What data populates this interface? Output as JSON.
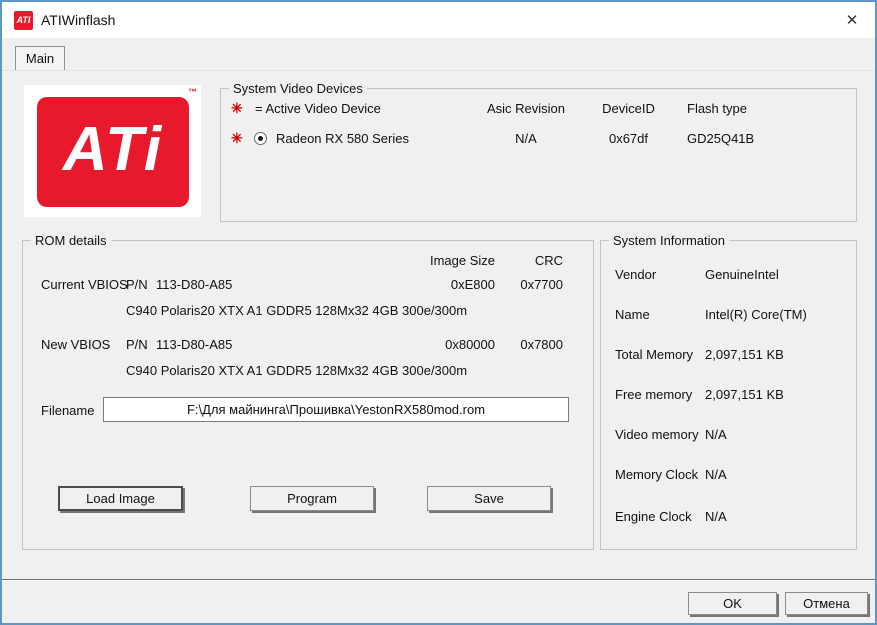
{
  "window": {
    "title": "ATIWinflash",
    "close_glyph": "✕"
  },
  "app_icon_text": "ATI",
  "tabs": {
    "main": "Main"
  },
  "logo": {
    "text": "ATi",
    "tm": "™"
  },
  "devices": {
    "legend": "System Video Devices",
    "marker_glyph": "✳",
    "active_label": "= Active Video Device",
    "col_asic": "Asic Revision",
    "col_deviceid": "DeviceID",
    "col_flashtype": "Flash type",
    "device": {
      "name": "Radeon RX 580 Series",
      "asic": "N/A",
      "deviceid": "0x67df",
      "flashtype": "GD25Q41B"
    }
  },
  "rom": {
    "legend": "ROM details",
    "col_image_size": "Image Size",
    "col_crc": "CRC",
    "current": {
      "label": "Current VBIOS",
      "pn_label": "P/N",
      "pn": "113-D80-A85",
      "size": "0xE800",
      "crc": "0x7700",
      "desc": "C940 Polaris20 XTX A1 GDDR5 128Mx32 4GB 300e/300m"
    },
    "new": {
      "label": "New VBIOS",
      "pn_label": "P/N",
      "pn": "113-D80-A85",
      "size": "0x80000",
      "crc": "0x7800",
      "desc": "C940 Polaris20 XTX A1 GDDR5 128Mx32 4GB 300e/300m"
    },
    "filename_label": "Filename",
    "filename_value": "F:\\Для майнинга\\Прошивка\\YestonRX580mod.rom",
    "buttons": {
      "load": "Load Image",
      "program": "Program",
      "save": "Save"
    }
  },
  "sysinfo": {
    "legend": "System Information",
    "rows": [
      {
        "label": "Vendor",
        "value": "GenuineIntel"
      },
      {
        "label": "Name",
        "value": "Intel(R) Core(TM)"
      },
      {
        "label": "Total Memory",
        "value": "2,097,151 KB"
      },
      {
        "label": "Free memory",
        "value": "2,097,151 KB"
      },
      {
        "label": "Video memory",
        "value": "N/A"
      },
      {
        "label": "Memory Clock",
        "value": "N/A"
      },
      {
        "label": "Engine Clock",
        "value": "N/A"
      }
    ]
  },
  "footer": {
    "ok": "OK",
    "cancel": "Отмена"
  },
  "colors": {
    "accent_red": "#e8192c",
    "border_blue": "#5f96c4"
  }
}
